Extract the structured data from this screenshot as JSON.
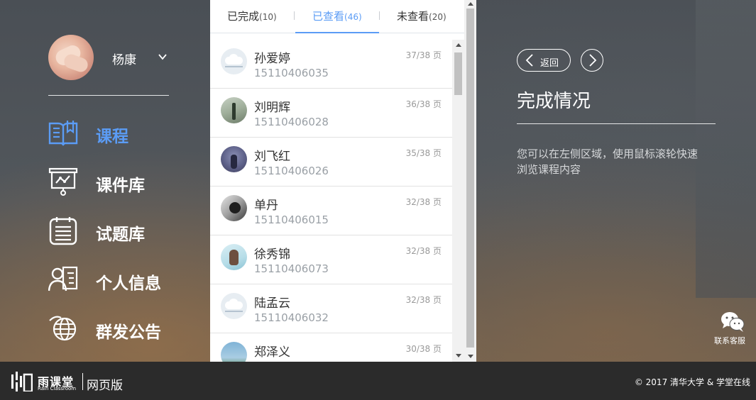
{
  "user": {
    "name": "杨康"
  },
  "nav": {
    "items": [
      {
        "label": "课程",
        "icon": "book-icon",
        "active": true
      },
      {
        "label": "课件库",
        "icon": "presentation-icon",
        "active": false
      },
      {
        "label": "试题库",
        "icon": "calendar-list-icon",
        "active": false
      },
      {
        "label": "个人信息",
        "icon": "profile-card-icon",
        "active": false
      },
      {
        "label": "群发公告",
        "icon": "globe-icon",
        "active": false
      }
    ],
    "active_color": "#5b9cf5"
  },
  "tabs": [
    {
      "label": "已完成",
      "count": "(10)",
      "active": false
    },
    {
      "label": "已查看",
      "count": "(46)",
      "active": true
    },
    {
      "label": "未查看",
      "count": "(20)",
      "active": false
    }
  ],
  "students": [
    {
      "name": "孙爱婷",
      "id": "15110406035",
      "progress": "37/38 页",
      "avatar": "default-avatar"
    },
    {
      "name": "刘明辉",
      "id": "15110406028",
      "progress": "36/38 页",
      "avatar": "photo-avatar"
    },
    {
      "name": "刘飞红",
      "id": "15110406026",
      "progress": "35/38 页",
      "avatar": "photo-avatar"
    },
    {
      "name": "单丹",
      "id": "15110406015",
      "progress": "32/38 页",
      "avatar": "photo-avatar"
    },
    {
      "name": "徐秀锦",
      "id": "15110406073",
      "progress": "32/38 页",
      "avatar": "photo-avatar"
    },
    {
      "name": "陆孟云",
      "id": "15110406032",
      "progress": "32/38 页",
      "avatar": "default-avatar"
    },
    {
      "name": "郑泽义",
      "id": "",
      "progress": "30/38 页",
      "avatar": "photo-avatar"
    }
  ],
  "info": {
    "back_label": "返回",
    "title": "完成情况",
    "hint": "您可以在左侧区域，使用鼠标滚轮快速浏览课程内容"
  },
  "support": {
    "label": "联系客服"
  },
  "footer": {
    "brand": "雨课堂",
    "brand_en": "Rain Classroom",
    "edition": "网页版",
    "copyright": "© 2017 清华大学 & 学堂在线"
  }
}
